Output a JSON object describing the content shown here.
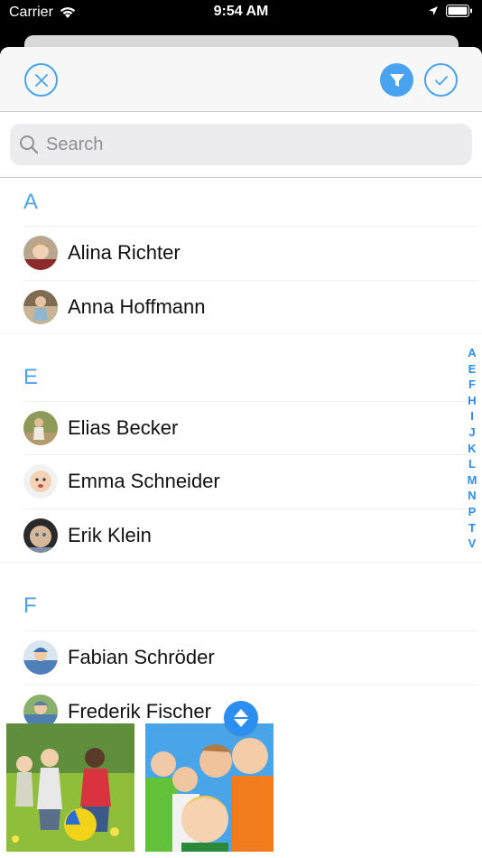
{
  "status_bar": {
    "carrier": "Carrier",
    "time": "9:54 AM"
  },
  "toolbar": {
    "close_icon": "close-circle-icon",
    "filter_icon": "filter-funnel-icon",
    "done_icon": "checkmark-circle-icon",
    "accent_color": "#4aa3f0"
  },
  "search": {
    "placeholder": "Search"
  },
  "sections": [
    {
      "letter": "A",
      "contacts": [
        "Alina Richter",
        "Anna Hoffmann"
      ]
    },
    {
      "letter": "E",
      "contacts": [
        "Elias Becker",
        "Emma Schneider",
        "Erik Klein"
      ]
    },
    {
      "letter": "F",
      "contacts": [
        "Fabian Schröder",
        "Frederik Fischer"
      ]
    }
  ],
  "index_letters": [
    "A",
    "E",
    "F",
    "H",
    "I",
    "J",
    "K",
    "L",
    "M",
    "N",
    "P",
    "T",
    "V"
  ],
  "thumbnails": [
    {
      "icon": "photo-kids-playing-ball"
    },
    {
      "icon": "photo-kids-group-smiling"
    }
  ],
  "sort_button_icon": "sort-up-down-icon"
}
